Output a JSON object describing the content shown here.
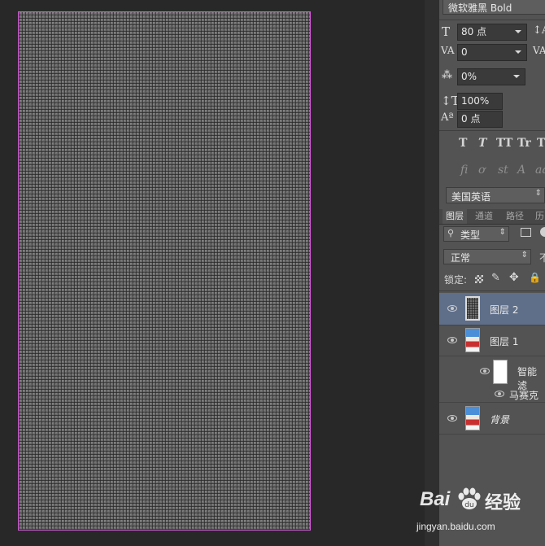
{
  "character": {
    "font_family": "微软雅黑 Bold",
    "font_size": "80 点",
    "tracking": "0",
    "scale_percent": "0%",
    "vertical_scale": "100%",
    "baseline_shift": "0 点",
    "typo_buttons": [
      "T",
      "T",
      "TT",
      "Tr",
      "T"
    ],
    "opentype_buttons": [
      "fi",
      "ơ",
      "st",
      "A",
      "aa"
    ],
    "language": "美国英语"
  },
  "layers_panel": {
    "tabs": [
      "图层",
      "通道",
      "路径",
      "历"
    ],
    "filter_kind": "类型",
    "blend_mode": "正常",
    "opacity_label_partial": "不",
    "lock_label": "锁定:",
    "layers": [
      {
        "name": "图层 2",
        "selected": true
      },
      {
        "name": "图层 1",
        "selected": false
      },
      {
        "name": "智能滤",
        "selected": false
      },
      {
        "name": "马赛克",
        "selected": false
      },
      {
        "name": "背景",
        "selected": false
      }
    ]
  },
  "watermark": {
    "brand": "Bai",
    "brand_cn": "经验",
    "url": "jingyan.baidu.com"
  },
  "colors": {
    "canvas_border": "#d25bd6",
    "selected_layer": "#5f6f8a",
    "panel_bg": "#535353"
  }
}
